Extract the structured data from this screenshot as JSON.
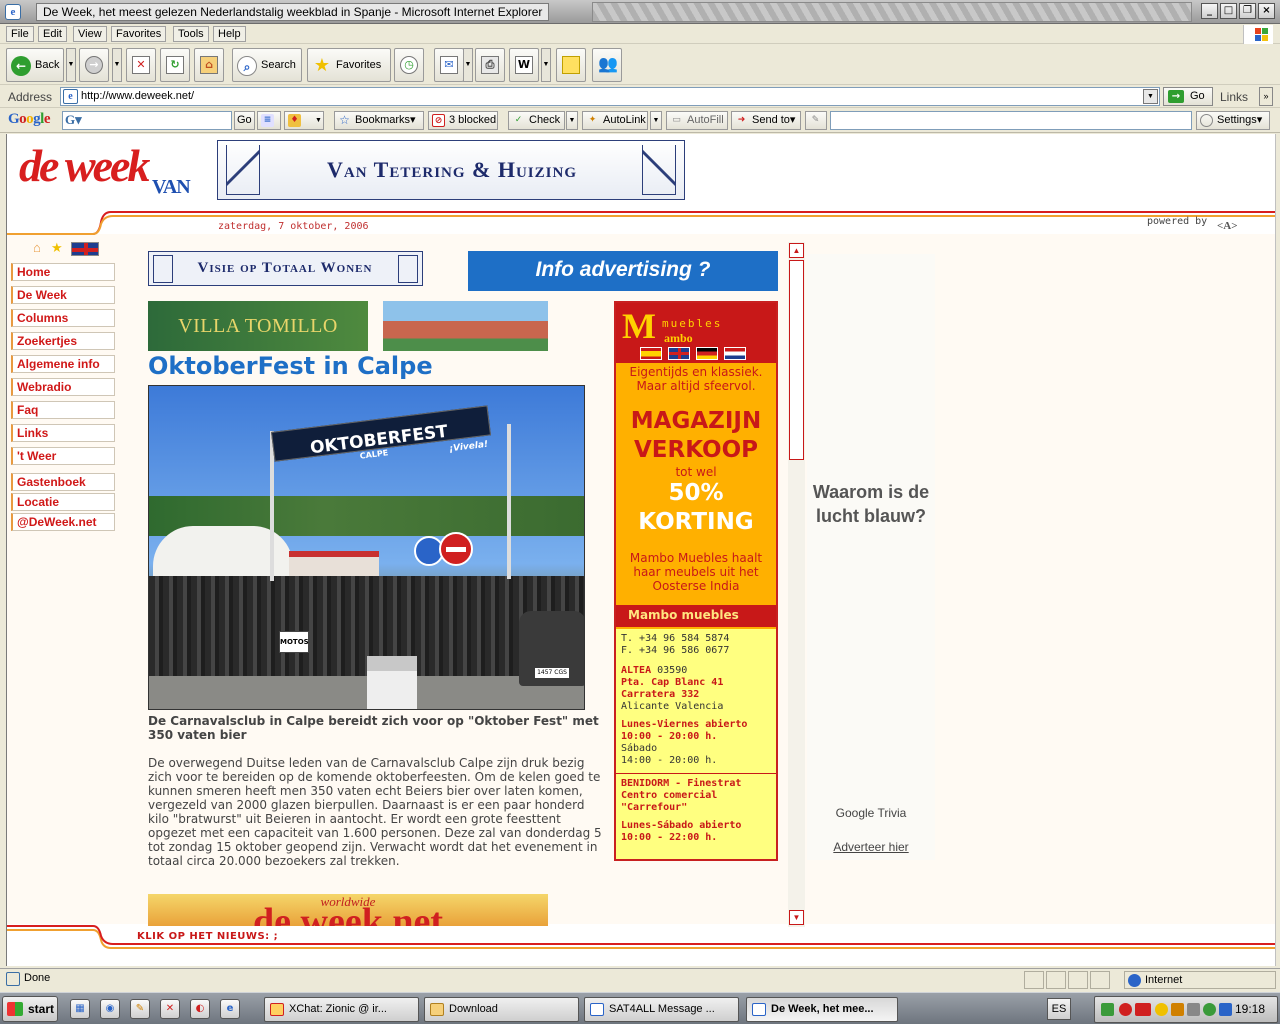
{
  "window": {
    "title": "De Week, het meest gelezen Nederlandstalig weekblad in Spanje - Microsoft Internet Explorer"
  },
  "menu": [
    "File",
    "Edit",
    "View",
    "Favorites",
    "Tools",
    "Help"
  ],
  "toolbar": {
    "back": "Back",
    "search": "Search",
    "favorites": "Favorites"
  },
  "address": {
    "label": "Address",
    "url": "http://www.deweek.net/",
    "go": "Go",
    "links": "Links"
  },
  "google_toolbar": {
    "logo": "Google",
    "go": "Go",
    "bookmarks": "Bookmarks",
    "blocked": "3 blocked",
    "check": "Check",
    "autolink": "AutoLink",
    "autofill": "AutoFill",
    "sendto": "Send to",
    "settings": "Settings"
  },
  "site": {
    "logo_main": "de week",
    "logo_sub": "VAN",
    "banner_top": "Van Tetering & Huizing",
    "date": "zaterdag, 7 oktober, 2006",
    "powered_by": "powered by",
    "powered_logo": "<A>",
    "nav": [
      "Home",
      "De Week",
      "Columns",
      "Zoekertjes",
      "Algemene info",
      "Webradio",
      "Faq",
      "Links",
      "'t Weer",
      "Gastenboek",
      "Locatie",
      "@DeWeek.net"
    ],
    "banner_visie": "Visie op Totaal Wonen",
    "banner_info": "Info advertising ?",
    "banner_villa": "VILLA TOMILLO",
    "headline": "OktoberFest in Calpe",
    "photo_banner": "OKTOBERFEST",
    "photo_banner_sub": "CALPE",
    "photo_banner_side": "¡Vivela!",
    "photo_sign": "MOTOS",
    "photo_plate": "1457 CGS",
    "caption": "De Carnavalsclub in Calpe bereidt zich voor op \"Oktober Fest\" met 350 vaten bier",
    "body": "De overwegend Duitse leden van de Carnavalsclub Calpe zijn druk bezig zich voor te bereiden op de komende oktoberfeesten. Om de kelen goed te kunnen smeren heeft men 350 vaten echt Beiers bier over laten komen, vergezeld van 2000 glazen bierpullen. Daarnaast is er een paar honderd kilo \"bratwurst\" uit Beieren in aantocht. Er wordt een grote feesttent opgezet met een capaciteit van 1.600 personen. Deze zal van donderdag 5 tot zondag 15 oktober geopend zijn. Verwacht wordt dat het evenement in totaal circa 20.000 bezoekers zal trekken.",
    "ww_small": "worldwide",
    "ww_big": "de week.net",
    "klik": "KLIK OP HET NIEUWS: ;"
  },
  "mambo": {
    "logo": "M",
    "muebles": "muebles",
    "brand": "ambo",
    "slogan": "Eigentijds en klassiek. Maar altijd sfeervol.",
    "magazijn": "MAGAZIJN VERKOOP",
    "totwel": "tot wel",
    "korting": "50% KORTING",
    "haalt": "Mambo Muebles haalt haar meubels uit het Oosterse India",
    "header": "Mambo muebles",
    "tel": "T. +34 96 584 5874",
    "fax": "F. +34 96 586 0677",
    "altea": "ALTEA",
    "altea_zip": " 03590",
    "addr1": "Pta. Cap Blanc 41",
    "addr2": "Carratera 332",
    "addr3": "Alicante Valencia",
    "hours1": "Lunes-Viernes abierto",
    "hours1b": "10:00 - 20:00 h.",
    "sabado": "Sábado",
    "sabado_h": "14:00 - 20:00 h.",
    "benidorm": "BENIDORM - Finestrat",
    "centro": "Centro comercial",
    "carrefour": "\"Carrefour\"",
    "hours2": "Lunes-Sábado abierto",
    "hours2b": "10:00 - 22:00 h."
  },
  "google_ad": {
    "question": "Waarom is de lucht blauw?",
    "trivia": "Google Trivia",
    "advertise": "Adverteer hier"
  },
  "status": {
    "text": "Done",
    "zone": "Internet"
  },
  "taskbar": {
    "start": "start",
    "tasks": [
      "XChat: Zionic @ ir...",
      "Download",
      "SAT4ALL Message ...",
      "De Week, het mee..."
    ],
    "lang": "ES",
    "clock": "19:18"
  }
}
